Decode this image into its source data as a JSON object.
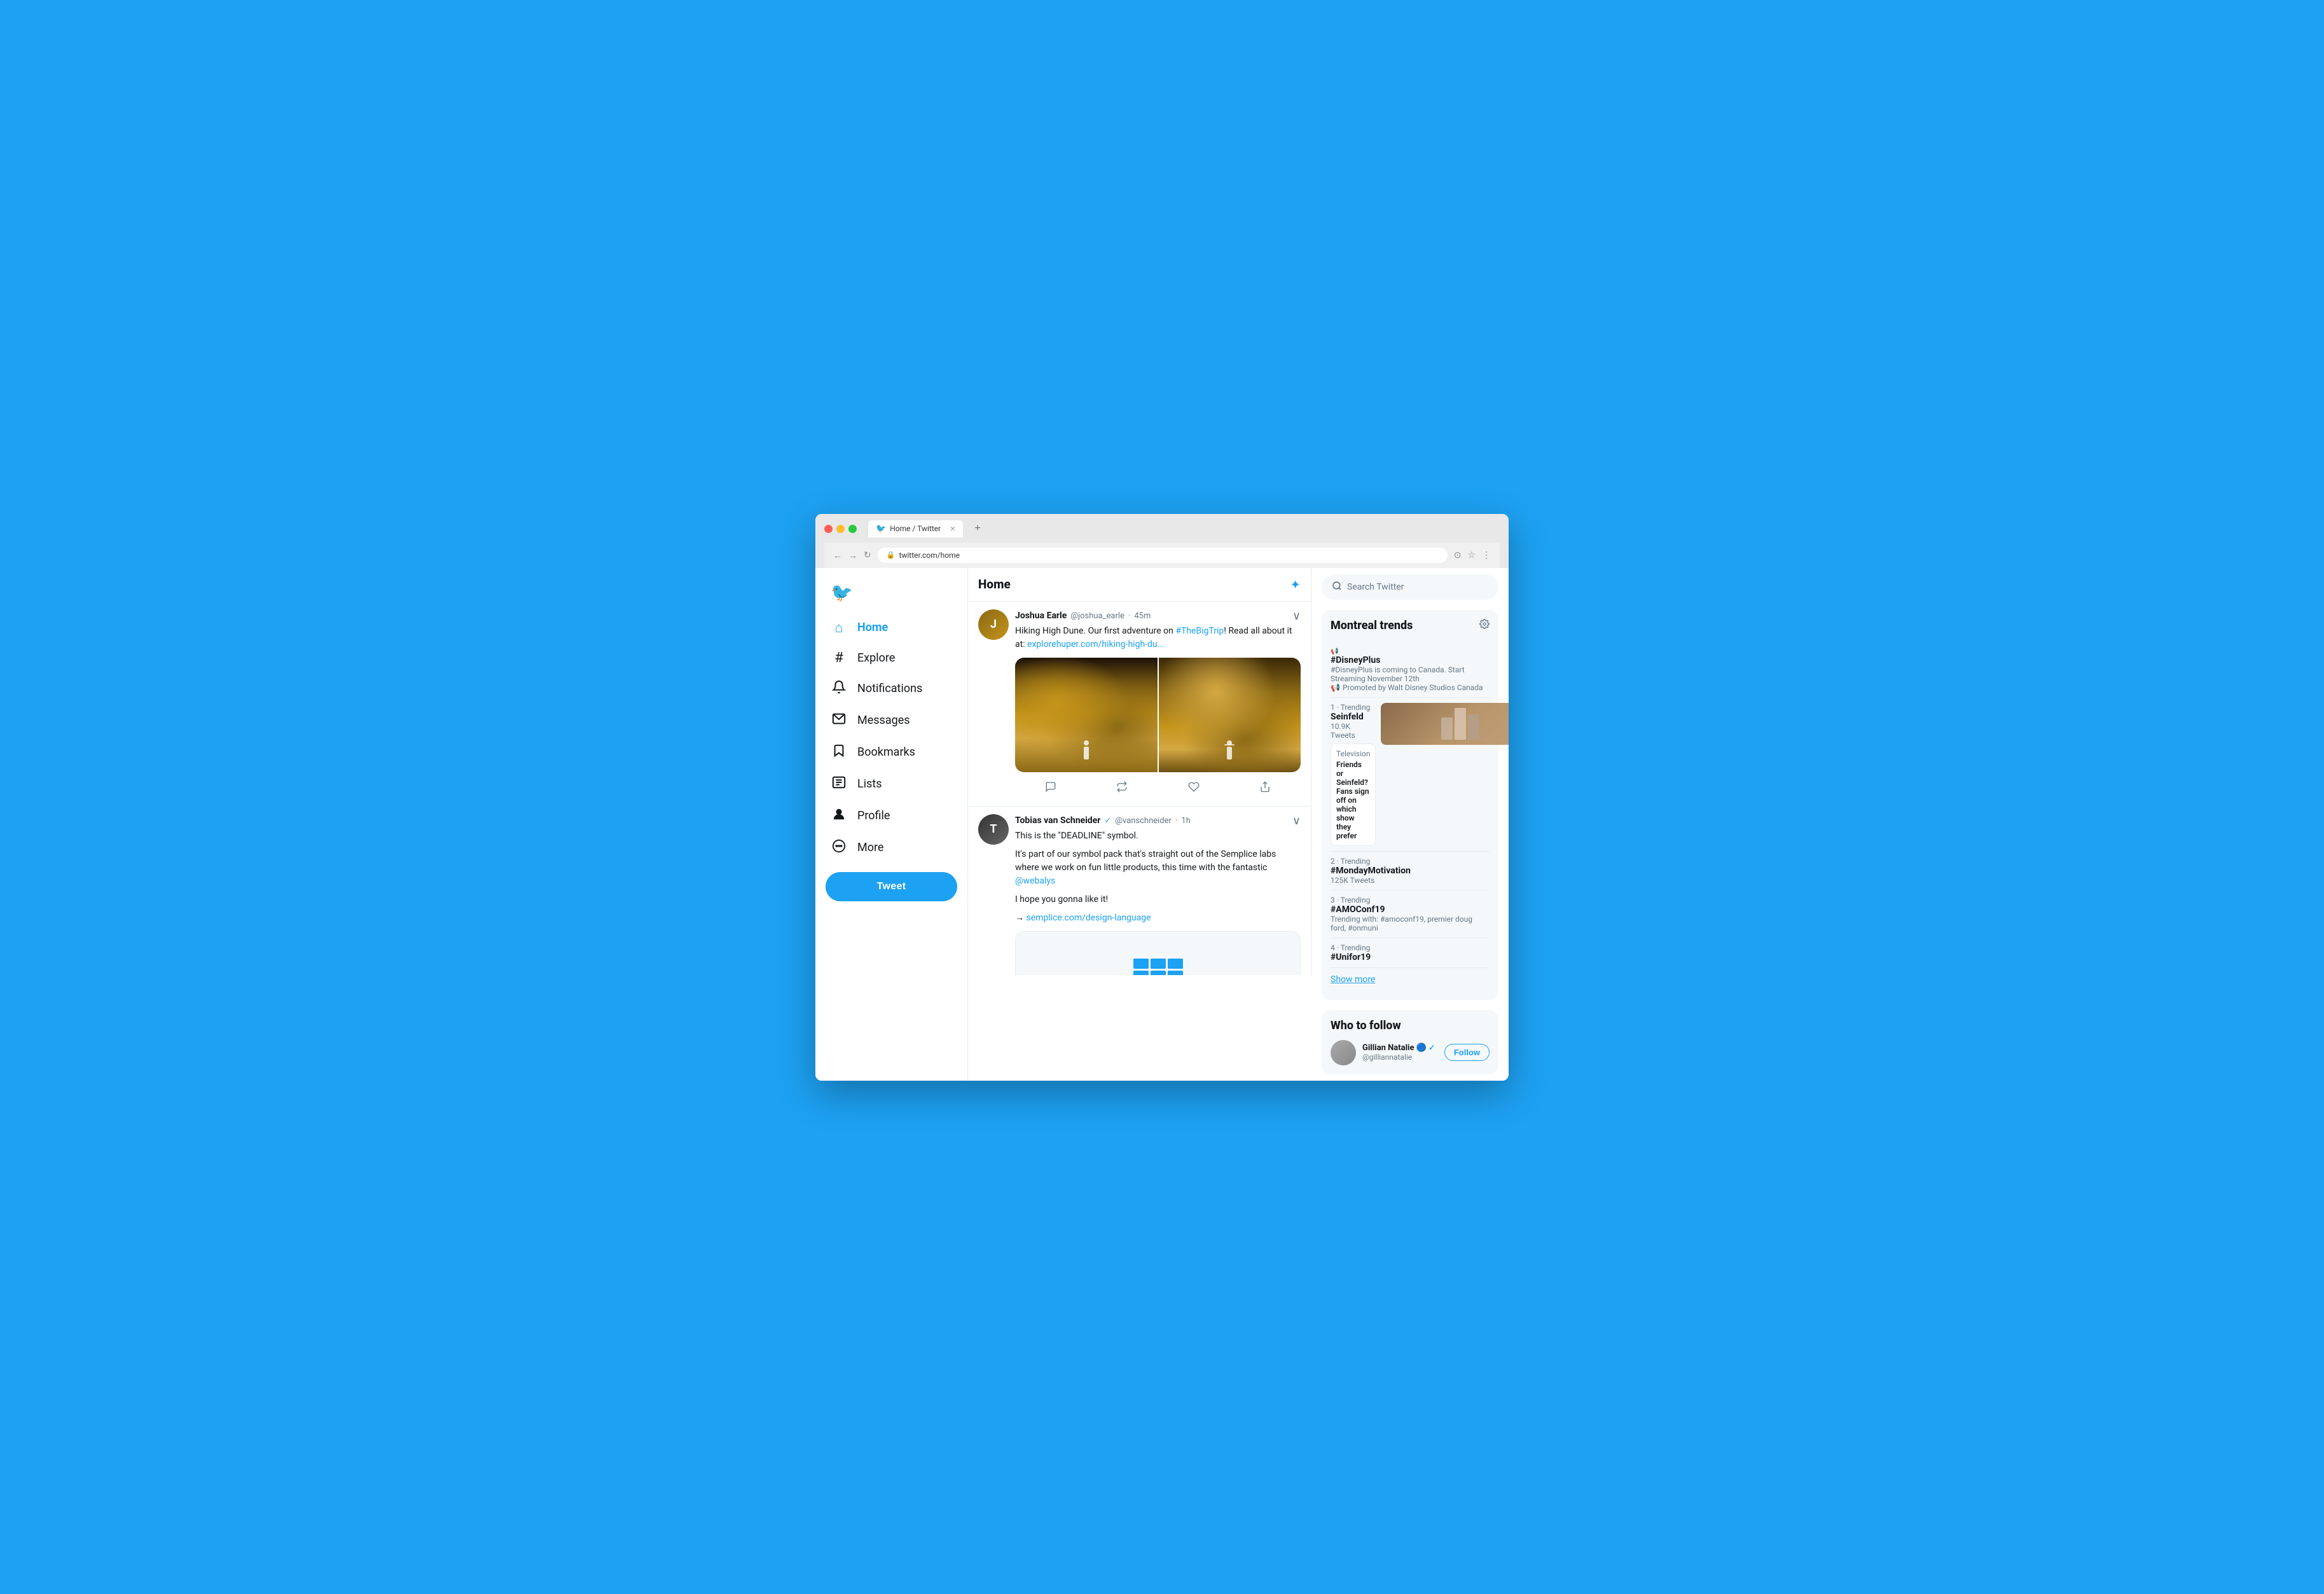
{
  "browser": {
    "url": "twitter.com/home",
    "tab_title": "Home / Twitter",
    "tab_favicon": "🐦"
  },
  "sidebar": {
    "logo_label": "Twitter",
    "nav_items": [
      {
        "id": "home",
        "label": "Home",
        "icon": "⌂",
        "active": true
      },
      {
        "id": "explore",
        "label": "Explore",
        "icon": "#"
      },
      {
        "id": "notifications",
        "label": "Notifications",
        "icon": "🔔"
      },
      {
        "id": "messages",
        "label": "Messages",
        "icon": "✉"
      },
      {
        "id": "bookmarks",
        "label": "Bookmarks",
        "icon": "🔖"
      },
      {
        "id": "lists",
        "label": "Lists",
        "icon": "☰"
      },
      {
        "id": "profile",
        "label": "Profile",
        "icon": "👤"
      },
      {
        "id": "more",
        "label": "More",
        "icon": "⋯"
      }
    ],
    "tweet_button_label": "Tweet"
  },
  "feed": {
    "title": "Home",
    "tweets": [
      {
        "id": "tweet1",
        "author_name": "Joshua Earle",
        "author_handle": "@joshua_earle",
        "time": "45m",
        "text": "Hiking High Dune. Our first adventure on #TheBigTrip! Read all about it at: explorehuper.com/hiking-high-du...",
        "link_text": "explorehuper.com/hiking-high-du...",
        "hashtag": "#TheBigTrip",
        "has_images": true
      },
      {
        "id": "tweet2",
        "author_name": "Tobias van Schneider",
        "author_handle": "@vanschneider",
        "time": "1h",
        "verified": true,
        "text_line1": "This is the \"DEADLINE\" symbol.",
        "text_line2": "It's part of our symbol pack that's straight out of the Semplice labs where we work on fun little products, this time with the fantastic @webalys",
        "text_line3": "I hope you gonna like it!",
        "text_line4": "→ semplice.com/design-language",
        "mention": "@webalys",
        "link": "semplice.com/design-language"
      }
    ]
  },
  "right_sidebar": {
    "search_placeholder": "Search Twitter",
    "trends_section": {
      "title": "Montreal trends",
      "items": [
        {
          "id": "disneyplus",
          "type": "promoted",
          "name": "#DisneyPlus",
          "description": "#DisneyPlus is coming to Canada. Start Streaming November 12th",
          "promo_label": "Promoted by Walt Disney Studios Canada"
        },
        {
          "id": "seinfeld",
          "category": "1 · Trending",
          "name": "Seinfeld",
          "count": "10.9K Tweets",
          "card_category": "Television",
          "card_text": "Friends or Seinfeld? Fans sign off on which show they prefer"
        },
        {
          "id": "mondaymotivation",
          "category": "2 · Trending",
          "name": "#MondayMotivation",
          "count": "125K Tweets"
        },
        {
          "id": "amoconf19",
          "category": "3 · Trending",
          "name": "#AMOConf19",
          "trending_with": "Trending with: #amoconf19, premier doug ford, #onmuni"
        },
        {
          "id": "unifor19",
          "category": "4 · Trending",
          "name": "#Unifor19"
        }
      ],
      "show_more_label": "Show more"
    },
    "who_to_follow": {
      "title": "Who to follow",
      "items": [
        {
          "id": "follow1",
          "name": "Gillian Natalie 🔵",
          "handle": "@gilliannatalie",
          "follow_label": "Follow"
        }
      ]
    }
  }
}
